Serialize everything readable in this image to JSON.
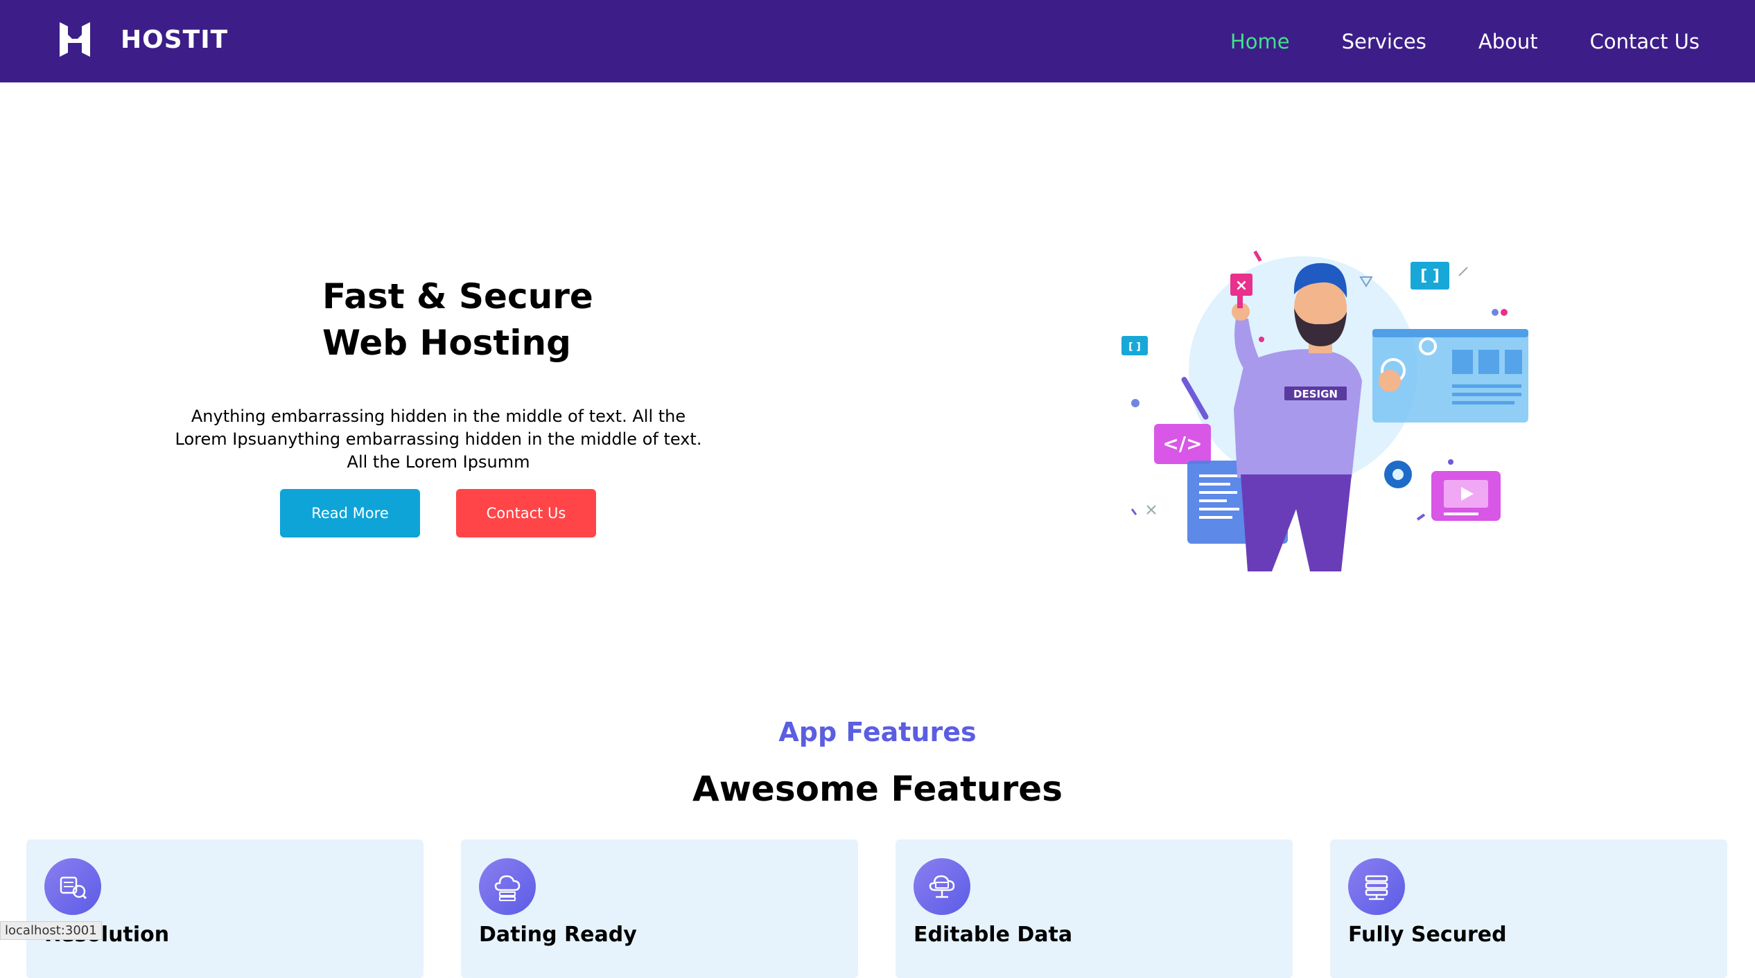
{
  "brand": {
    "name": "HOSTIT",
    "logo_icon": "h-logo-icon"
  },
  "nav": {
    "items": [
      {
        "label": "Home",
        "active": true
      },
      {
        "label": "Services",
        "active": false
      },
      {
        "label": "About",
        "active": false
      },
      {
        "label": "Contact Us",
        "active": false
      }
    ]
  },
  "hero": {
    "title_line1": "Fast & Secure",
    "title_line2": "Web Hosting",
    "description": "Anything embarrassing hidden in the middle of text. All the Lorem Ipsuanything embarrassing hidden in the middle of text. All the Lorem Ipsumm",
    "read_more_label": "Read More",
    "contact_label": "Contact Us",
    "illustration_label": "DESIGN"
  },
  "features": {
    "eyebrow": "App Features",
    "title": "Awesome Features",
    "cards": [
      {
        "title": "Resolution",
        "icon": "resolution-icon"
      },
      {
        "title": "Dating Ready",
        "icon": "cloud-server-icon"
      },
      {
        "title": "Editable Data",
        "icon": "cloud-editable-icon"
      },
      {
        "title": "Fully Secured",
        "icon": "server-stack-icon"
      }
    ]
  },
  "status_bar": {
    "url": "localhost:3001"
  },
  "colors": {
    "navbar_bg": "#3d1e88",
    "nav_active": "#43e08a",
    "accent_purple": "#5b5ee0",
    "btn_blue": "#0ea4d8",
    "btn_red": "#ff4548",
    "card_bg": "#e6f3fd"
  }
}
